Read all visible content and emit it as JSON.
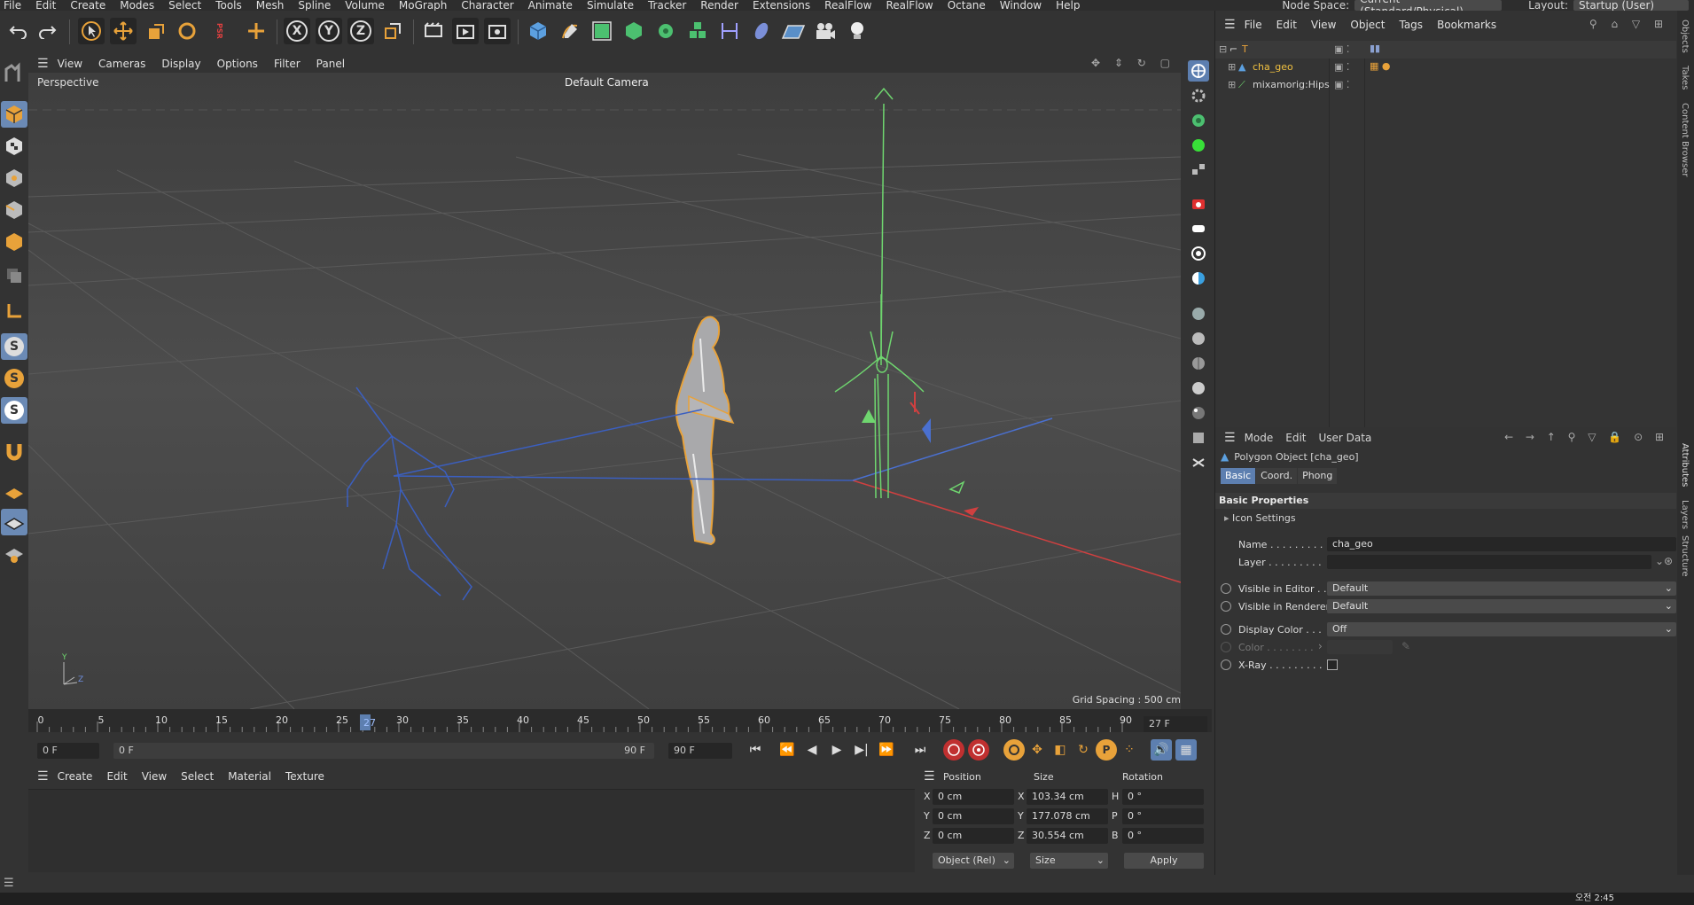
{
  "menubar": {
    "items": [
      "File",
      "Edit",
      "Create",
      "Modes",
      "Select",
      "Tools",
      "Mesh",
      "Spline",
      "Volume",
      "MoGraph",
      "Character",
      "Animate",
      "Simulate",
      "Tracker",
      "Render",
      "Extensions",
      "RealFlow",
      "RealFlow",
      "Octane",
      "Window",
      "Help"
    ],
    "node_space_label": "Node Space:",
    "node_space_value": "Current (Standard/Physical)",
    "layout_label": "Layout:",
    "layout_value": "Startup (User)"
  },
  "toolbar": {
    "axis_x": "X",
    "axis_y": "Y",
    "axis_z": "Z",
    "psr": "PSR"
  },
  "viewport": {
    "menu": [
      "View",
      "Cameras",
      "Display",
      "Options",
      "Filter",
      "Panel"
    ],
    "title": "Perspective",
    "camera": "Default Camera",
    "grid_spacing": "Grid Spacing : 500 cm",
    "axis_y": "Y",
    "axis_z": "Z"
  },
  "timeline": {
    "ticks": [
      "0",
      "5",
      "10",
      "15",
      "20",
      "25",
      "30",
      "35",
      "40",
      "45",
      "50",
      "55",
      "60",
      "65",
      "70",
      "75",
      "80",
      "85",
      "90"
    ],
    "current_frame": "27",
    "frame_field": "27 F"
  },
  "transport": {
    "start_field": "0 F",
    "range_start": "0 F",
    "range_end": "90 F",
    "end_field": "90 F"
  },
  "material_manager": {
    "menu": [
      "Create",
      "Edit",
      "View",
      "Select",
      "Material",
      "Texture"
    ]
  },
  "coordinates": {
    "headers": [
      "Position",
      "Size",
      "Rotation"
    ],
    "rows": [
      {
        "pos_axis": "X",
        "pos": "0 cm",
        "size_axis": "X",
        "size": "103.34 cm",
        "rot_axis": "H",
        "rot": "0 °"
      },
      {
        "pos_axis": "Y",
        "pos": "0 cm",
        "size_axis": "Y",
        "size": "177.078 cm",
        "rot_axis": "P",
        "rot": "0 °"
      },
      {
        "pos_axis": "Z",
        "pos": "0 cm",
        "size_axis": "Z",
        "size": "30.554 cm",
        "rot_axis": "B",
        "rot": "0 °"
      }
    ],
    "mode_select": "Object (Rel)",
    "size_select": "Size",
    "apply_label": "Apply"
  },
  "object_manager": {
    "menu": [
      "File",
      "Edit",
      "View",
      "Object",
      "Tags",
      "Bookmarks"
    ],
    "objects": [
      {
        "name": "T",
        "color": "#e8a23a"
      },
      {
        "name": "cha_geo",
        "color": "#f0c040"
      },
      {
        "name": "mixamorig:Hips",
        "color": "#d4d4d4"
      }
    ]
  },
  "attributes": {
    "menu": [
      "Mode",
      "Edit",
      "User Data"
    ],
    "object_title": "Polygon Object [cha_geo]",
    "tabs": [
      "Basic",
      "Coord.",
      "Phong"
    ],
    "section": "Basic Properties",
    "icon_settings": "Icon Settings",
    "name_label": "Name . . . . . . . . .",
    "name_value": "cha_geo",
    "layer_label": "Layer . . . . . . . . .",
    "visible_editor_label": "Visible in Editor . .",
    "visible_editor_value": "Default",
    "visible_renderer_label": "Visible in Renderer",
    "visible_renderer_value": "Default",
    "display_color_label": "Display Color . . .",
    "display_color_value": "Off",
    "color_label": "Color . . . . . . . .",
    "xray_label": "X-Ray . . . . . . . . .",
    "xray_checked": false
  },
  "side_tabs": {
    "top": [
      "Objects",
      "Takes",
      "Content Browser"
    ],
    "bottom": [
      "Attributes",
      "Layers",
      "Structure"
    ]
  },
  "taskbar": {
    "clock": "오전 2:45"
  },
  "colors": {
    "accent": "#5d7fb0",
    "selection_orange": "#e8a23a",
    "skeleton_green": "#6fd66f",
    "skeleton_blue": "#3b5fc0",
    "axis_red": "#e04040"
  }
}
